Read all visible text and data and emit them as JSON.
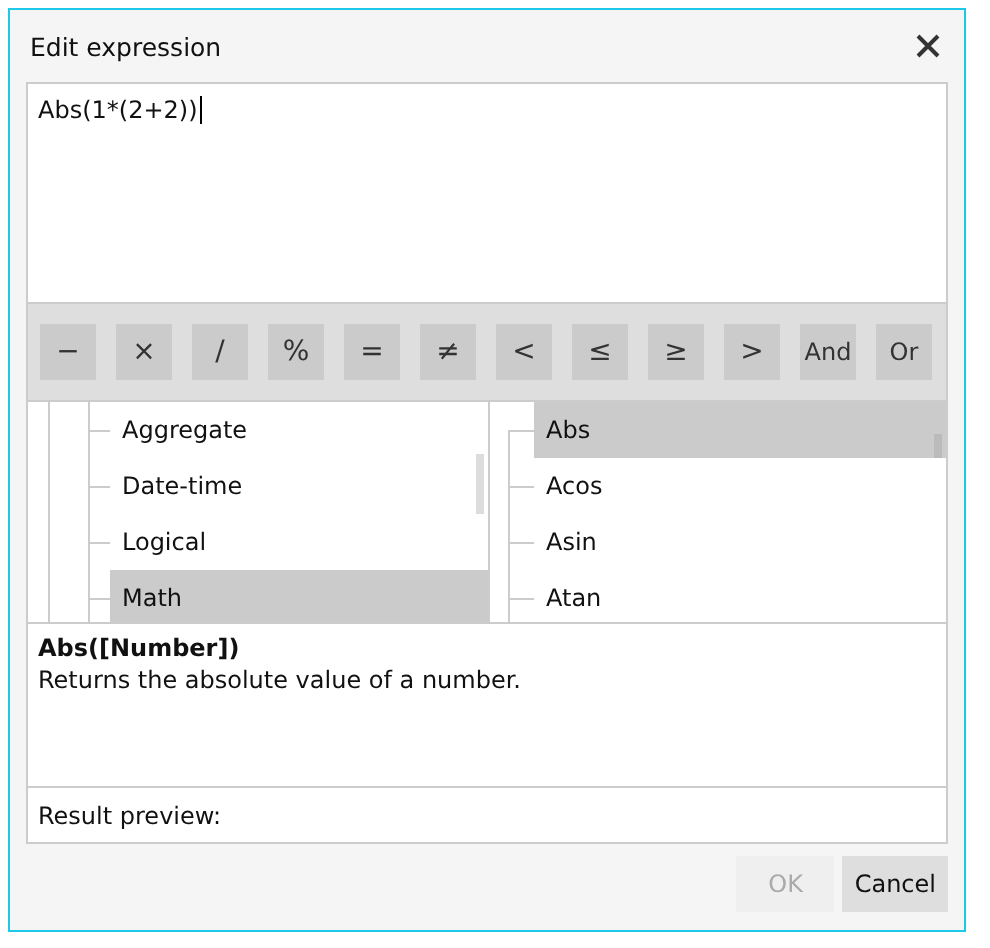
{
  "window": {
    "title": "Edit expression"
  },
  "expression": {
    "value": "Abs(1*(2+2))"
  },
  "operators": [
    "−",
    "×",
    "/",
    "%",
    "=",
    "≠",
    "<",
    "≤",
    "≥",
    ">",
    "And",
    "Or"
  ],
  "categories": [
    {
      "label": "Aggregate",
      "selected": false
    },
    {
      "label": "Date-time",
      "selected": false
    },
    {
      "label": "Logical",
      "selected": false
    },
    {
      "label": "Math",
      "selected": true
    }
  ],
  "functions": [
    {
      "label": "Abs",
      "selected": true
    },
    {
      "label": "Acos",
      "selected": false
    },
    {
      "label": "Asin",
      "selected": false
    },
    {
      "label": "Atan",
      "selected": false
    }
  ],
  "description": {
    "signature": "Abs([Number])",
    "text": "Returns the absolute value of a number."
  },
  "result_preview": {
    "label": "Result preview:"
  },
  "buttons": [
    {
      "label": "OK",
      "disabled": true
    },
    {
      "label": "Cancel",
      "disabled": false
    }
  ]
}
